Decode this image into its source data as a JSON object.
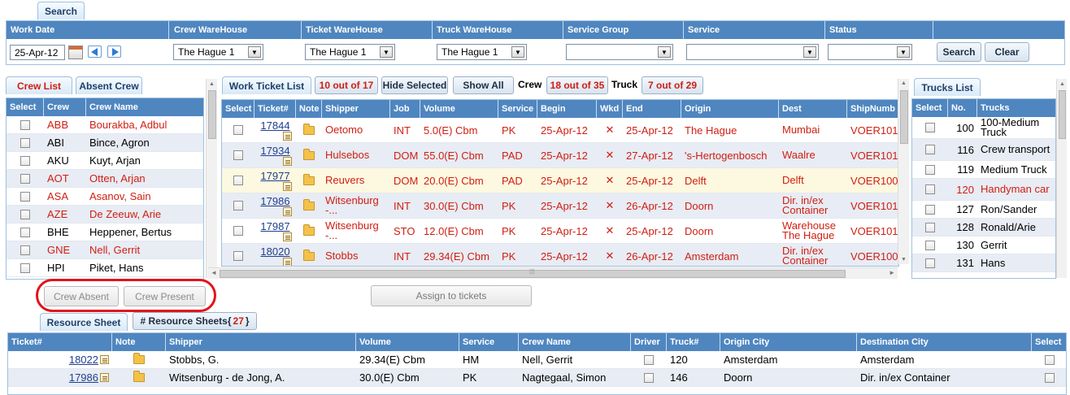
{
  "search_tab": "Search",
  "filters": {
    "headers": [
      "Work Date",
      "Crew WareHouse",
      "Ticket WareHouse",
      "Truck WareHouse",
      "Service Group",
      "Service",
      "Status"
    ],
    "work_date": "25-Apr-12",
    "crew_warehouse": "The Hague 1",
    "ticket_warehouse": "The Hague 1",
    "truck_warehouse": "The Hague 1",
    "service_group": "",
    "service": "",
    "status": "",
    "search_button": "Search",
    "clear_button": "Clear"
  },
  "crew": {
    "tab_list": "Crew List",
    "tab_absent": "Absent Crew",
    "headers": [
      "Select",
      "Crew",
      "Crew Name"
    ],
    "rows": [
      {
        "code": "ABB",
        "name": "Bourakba, Adbul",
        "red": true
      },
      {
        "code": "ABI",
        "name": "Bince, Agron",
        "red": false
      },
      {
        "code": "AKU",
        "name": "Kuyt, Arjan",
        "red": false
      },
      {
        "code": "AOT",
        "name": "Otten, Arjan",
        "red": true
      },
      {
        "code": "ASA",
        "name": "Asanov, Sain",
        "red": true
      },
      {
        "code": "AZE",
        "name": "De Zeeuw, Arie",
        "red": true
      },
      {
        "code": "BHE",
        "name": "Heppener, Bertus",
        "red": false
      },
      {
        "code": "GNE",
        "name": "Nell, Gerrit",
        "red": true
      },
      {
        "code": "HPI",
        "name": "Piket, Hans",
        "red": false
      }
    ],
    "absent_button": "Crew Absent",
    "present_button": "Crew Present"
  },
  "tickets": {
    "tab": "Work Ticket List",
    "count_btn": "10 out of 17",
    "hide_selected": "Hide Selected",
    "show_all": "Show All",
    "crew_label": "Crew",
    "crew_count": "18 out of 35",
    "truck_label": "Truck",
    "truck_count": "7 out of 29",
    "headers": [
      "Select",
      "Ticket#",
      "Note",
      "Shipper",
      "Job",
      "Volume",
      "Service",
      "Begin",
      "Wkd",
      "End",
      "Origin",
      "Dest",
      "ShipNumb"
    ],
    "rows": [
      {
        "ticket": "17844",
        "shipper": "Oetomo",
        "job": "INT",
        "volume": "5.0(E) Cbm",
        "service": "PK",
        "begin": "25-Apr-12",
        "wkd": "✕",
        "end": "25-Apr-12",
        "origin": "The Hague",
        "dest": "Mumbai",
        "ship": "VOER101"
      },
      {
        "ticket": "17934",
        "shipper": "Hulsebos",
        "job": "DOM",
        "volume": "55.0(E) Cbm",
        "service": "PAD",
        "begin": "25-Apr-12",
        "wkd": "✕",
        "end": "27-Apr-12",
        "origin": "'s-Hertogenbosch",
        "dest": "Waalre",
        "ship": "VOER101"
      },
      {
        "ticket": "17977",
        "shipper": "Reuvers",
        "job": "DOM",
        "volume": "20.0(E) Cbm",
        "service": "PAD",
        "begin": "25-Apr-12",
        "wkd": "✕",
        "end": "25-Apr-12",
        "origin": "Delft",
        "dest": "Delft",
        "ship": "VOER100"
      },
      {
        "ticket": "17986",
        "shipper": "Witsenburg -...",
        "job": "INT",
        "volume": "30.0(E) Cbm",
        "service": "PK",
        "begin": "25-Apr-12",
        "wkd": "✕",
        "end": "26-Apr-12",
        "origin": "Doorn",
        "dest": "Dir. in/ex Container",
        "ship": "VOER101"
      },
      {
        "ticket": "17987",
        "shipper": "Witsenburg -...",
        "job": "STO",
        "volume": "12.0(E) Cbm",
        "service": "PK",
        "begin": "25-Apr-12",
        "wkd": "✕",
        "end": "25-Apr-12",
        "origin": "Doorn",
        "dest": "Warehouse The Hague",
        "ship": "VOER101"
      },
      {
        "ticket": "18020",
        "shipper": "Stobbs",
        "job": "INT",
        "volume": "29.34(E) Cbm",
        "service": "PK",
        "begin": "25-Apr-12",
        "wkd": "✕",
        "end": "26-Apr-12",
        "origin": "Amsterdam",
        "dest": "Dir. in/ex Container",
        "ship": "VOER100"
      }
    ],
    "assign_button": "Assign to tickets"
  },
  "trucks": {
    "tab": "Trucks List",
    "headers": [
      "Select",
      "No.",
      "Trucks"
    ],
    "rows": [
      {
        "no": "100",
        "name": "100-Medium Truck",
        "red": false
      },
      {
        "no": "116",
        "name": "Crew transport",
        "red": false
      },
      {
        "no": "119",
        "name": "Medium Truck",
        "red": false
      },
      {
        "no": "120",
        "name": "Handyman car",
        "red": true
      },
      {
        "no": "127",
        "name": "Ron/Sander",
        "red": false
      },
      {
        "no": "128",
        "name": "Ronald/Arie",
        "red": false
      },
      {
        "no": "130",
        "name": "Gerrit",
        "red": false
      },
      {
        "no": "131",
        "name": "Hans",
        "red": false
      }
    ]
  },
  "resource": {
    "tab_sheet": "Resource Sheet",
    "tab_sheets_label": "# Resource Sheets{",
    "tab_sheets_count": "27",
    "tab_sheets_close": "}",
    "headers": [
      "Ticket#",
      "Note",
      "Shipper",
      "Volume",
      "Service",
      "Crew Name",
      "Driver",
      "Truck#",
      "Origin City",
      "Destination City",
      "Select"
    ],
    "rows": [
      {
        "ticket": "18022",
        "shipper": "Stobbs, G.",
        "volume": "29.34(E) Cbm",
        "service": "HM",
        "crew": "Nell, Gerrit",
        "truck": "120",
        "origin": "Amsterdam",
        "dest": "Amsterdam"
      },
      {
        "ticket": "17986",
        "shipper": "Witsenburg - de Jong, A.",
        "volume": "30.0(E) Cbm",
        "service": "PK",
        "crew": "Nagtegaal, Simon",
        "truck": "146",
        "origin": "Doorn",
        "dest": "Dir. in/ex Container"
      }
    ]
  },
  "colors": {
    "header_blue": "#4f86c0",
    "accent_red": "#d01e12",
    "highlight_row": "#fdf9e0",
    "alt_row": "#e8ecf4",
    "annotation": "#e3141b"
  }
}
